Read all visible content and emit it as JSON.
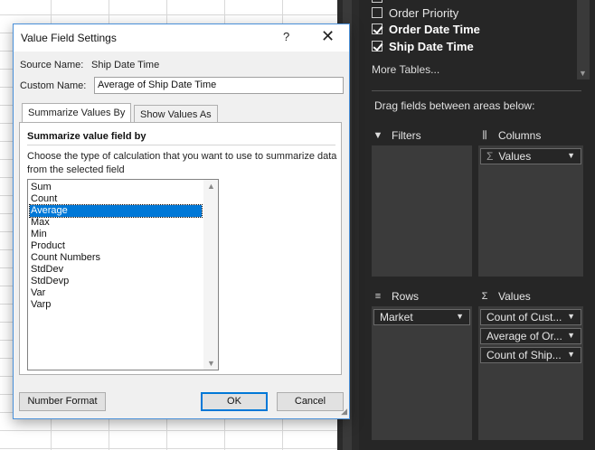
{
  "fields": [
    {
      "label": "Order Priority",
      "checked": false,
      "bold": false
    },
    {
      "label": "Order Date Time",
      "checked": true,
      "bold": true
    },
    {
      "label": "Ship Date Time",
      "checked": true,
      "bold": true
    }
  ],
  "more_tables": "More Tables...",
  "drag_hint": "Drag fields between areas below:",
  "areas": {
    "filters": {
      "label": "Filters"
    },
    "columns": {
      "label": "Columns",
      "items": [
        "Values"
      ]
    },
    "rows": {
      "label": "Rows",
      "items": [
        "Market"
      ]
    },
    "values": {
      "label": "Values",
      "items": [
        "Count of Cust...",
        "Average of Or...",
        "Count of Ship..."
      ]
    }
  },
  "dialog": {
    "title": "Value Field Settings",
    "help": "?",
    "close": "✕",
    "source_label": "Source Name:",
    "source_value": "Ship Date Time",
    "custom_label": "Custom Name:",
    "custom_value": "Average of Ship Date Time",
    "tabs": [
      "Summarize Values By",
      "Show Values As"
    ],
    "section_title": "Summarize value field by",
    "description": "Choose the type of calculation that you want to use to summarize data from the selected field",
    "functions": [
      "Sum",
      "Count",
      "Average",
      "Max",
      "Min",
      "Product",
      "Count Numbers",
      "StdDev",
      "StdDevp",
      "Var",
      "Varp"
    ],
    "selected_function": "Average",
    "number_format": "Number Format",
    "ok": "OK",
    "cancel": "Cancel"
  }
}
